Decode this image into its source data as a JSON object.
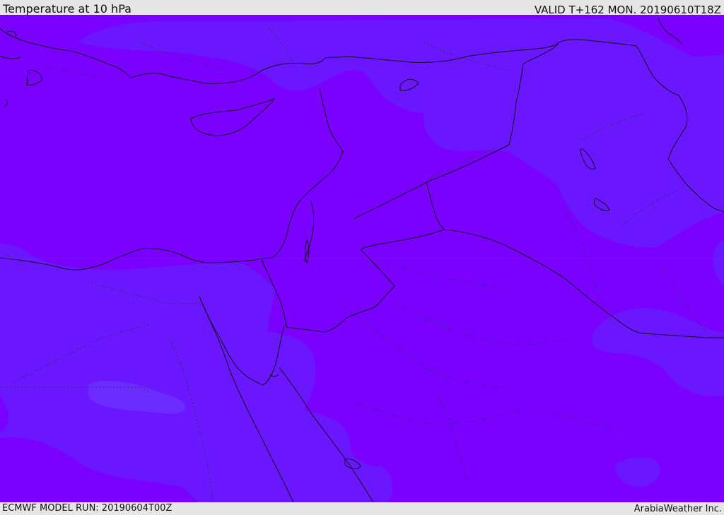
{
  "header": {
    "title": "Temperature at 10 hPa",
    "valid_time": "VALID T+162 MON. 20190610T18Z"
  },
  "footer": {
    "model_run": "ECMWF MODEL RUN: 20190604T00Z",
    "provider": "ArabiaWeather Inc."
  },
  "map": {
    "variable": "temperature",
    "level": "10 hPa",
    "colors": {
      "warmer_band": "#7a00ff",
      "cooler_band": "#6a16ff",
      "coastline": "#111111",
      "border": "#111111",
      "admin_border": "#333355"
    }
  }
}
